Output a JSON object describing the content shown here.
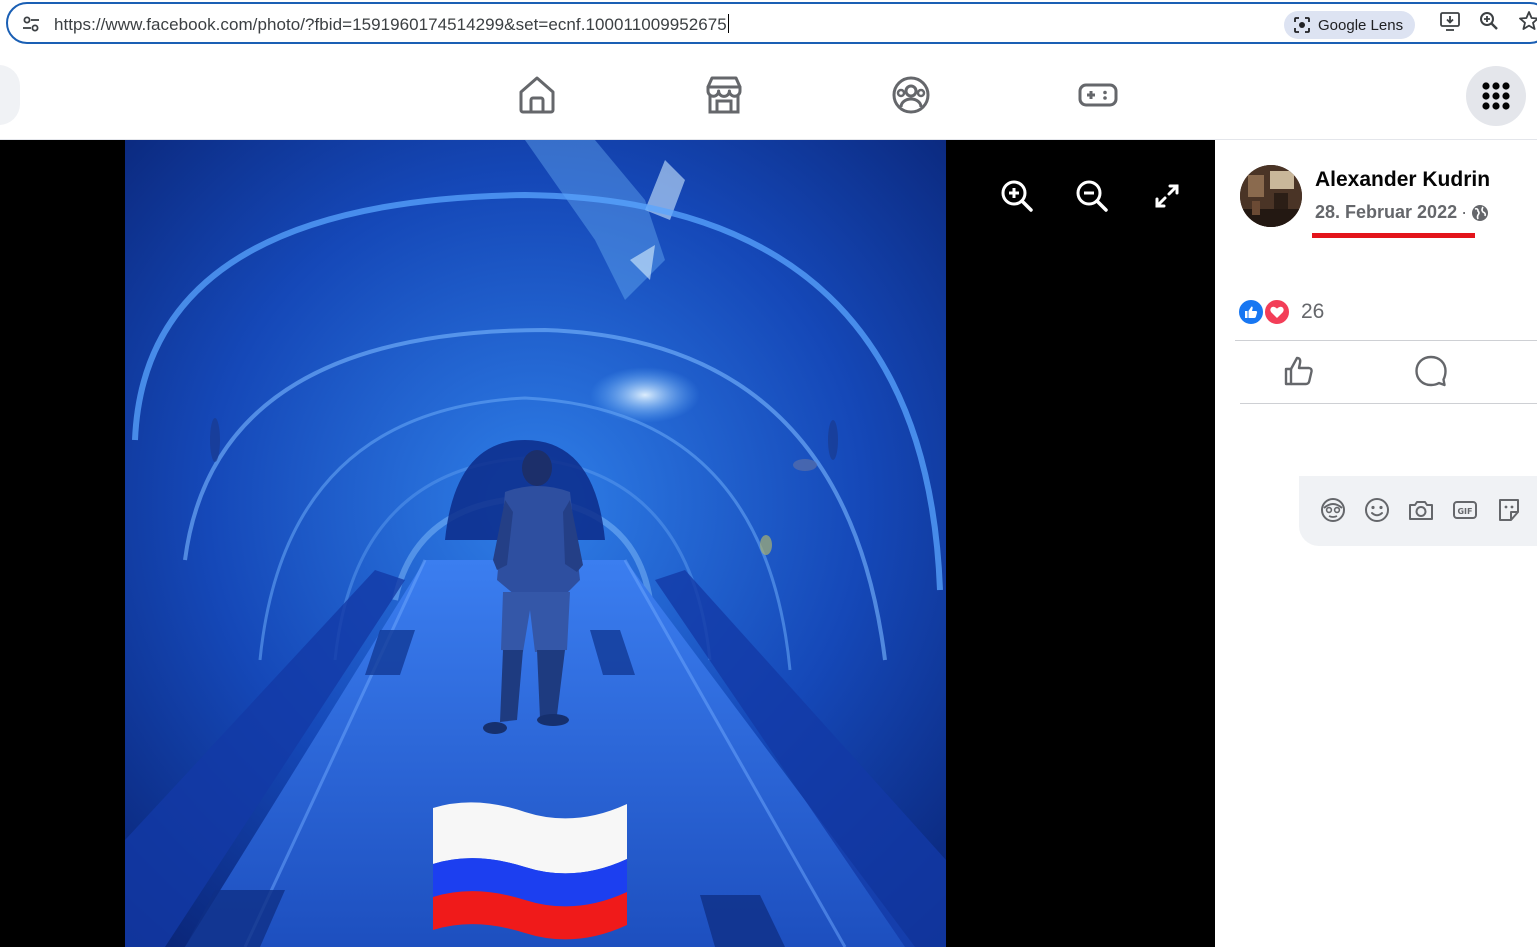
{
  "browser": {
    "url": "https://www.facebook.com/photo/?fbid=1591960174514299&set=ecnf.100011009952675",
    "lens_label": "Google Lens",
    "icons": [
      "tune-icon",
      "google-lens-icon",
      "install-app-icon",
      "zoom-icon",
      "bookmark-star-icon"
    ]
  },
  "nav": {
    "icons": [
      "home-icon",
      "marketplace-icon",
      "groups-icon",
      "gaming-icon",
      "menu-grid-icon"
    ]
  },
  "viewer": {
    "tools": [
      "zoom-in-icon",
      "zoom-out-icon",
      "fullscreen-icon"
    ],
    "flag": "russian-flag"
  },
  "post": {
    "author": "Alexander Kudrin",
    "date": "28. Februar 2022",
    "separator": "·",
    "privacy_icon": "globe-icon",
    "reaction_count": "26",
    "reaction_icons": [
      "like-reaction-icon",
      "love-reaction-icon"
    ],
    "actions": [
      "like-icon",
      "comment-icon"
    ],
    "comment_tools": [
      "avatar-sticker-icon",
      "emoji-icon",
      "camera-icon",
      "gif-icon",
      "sticker-icon"
    ]
  },
  "colors": {
    "facebook_blue": "#1877f2",
    "love_red": "#f33e58",
    "annotation_red": "#e3141b",
    "omnibox_border": "#1a5fb4"
  }
}
